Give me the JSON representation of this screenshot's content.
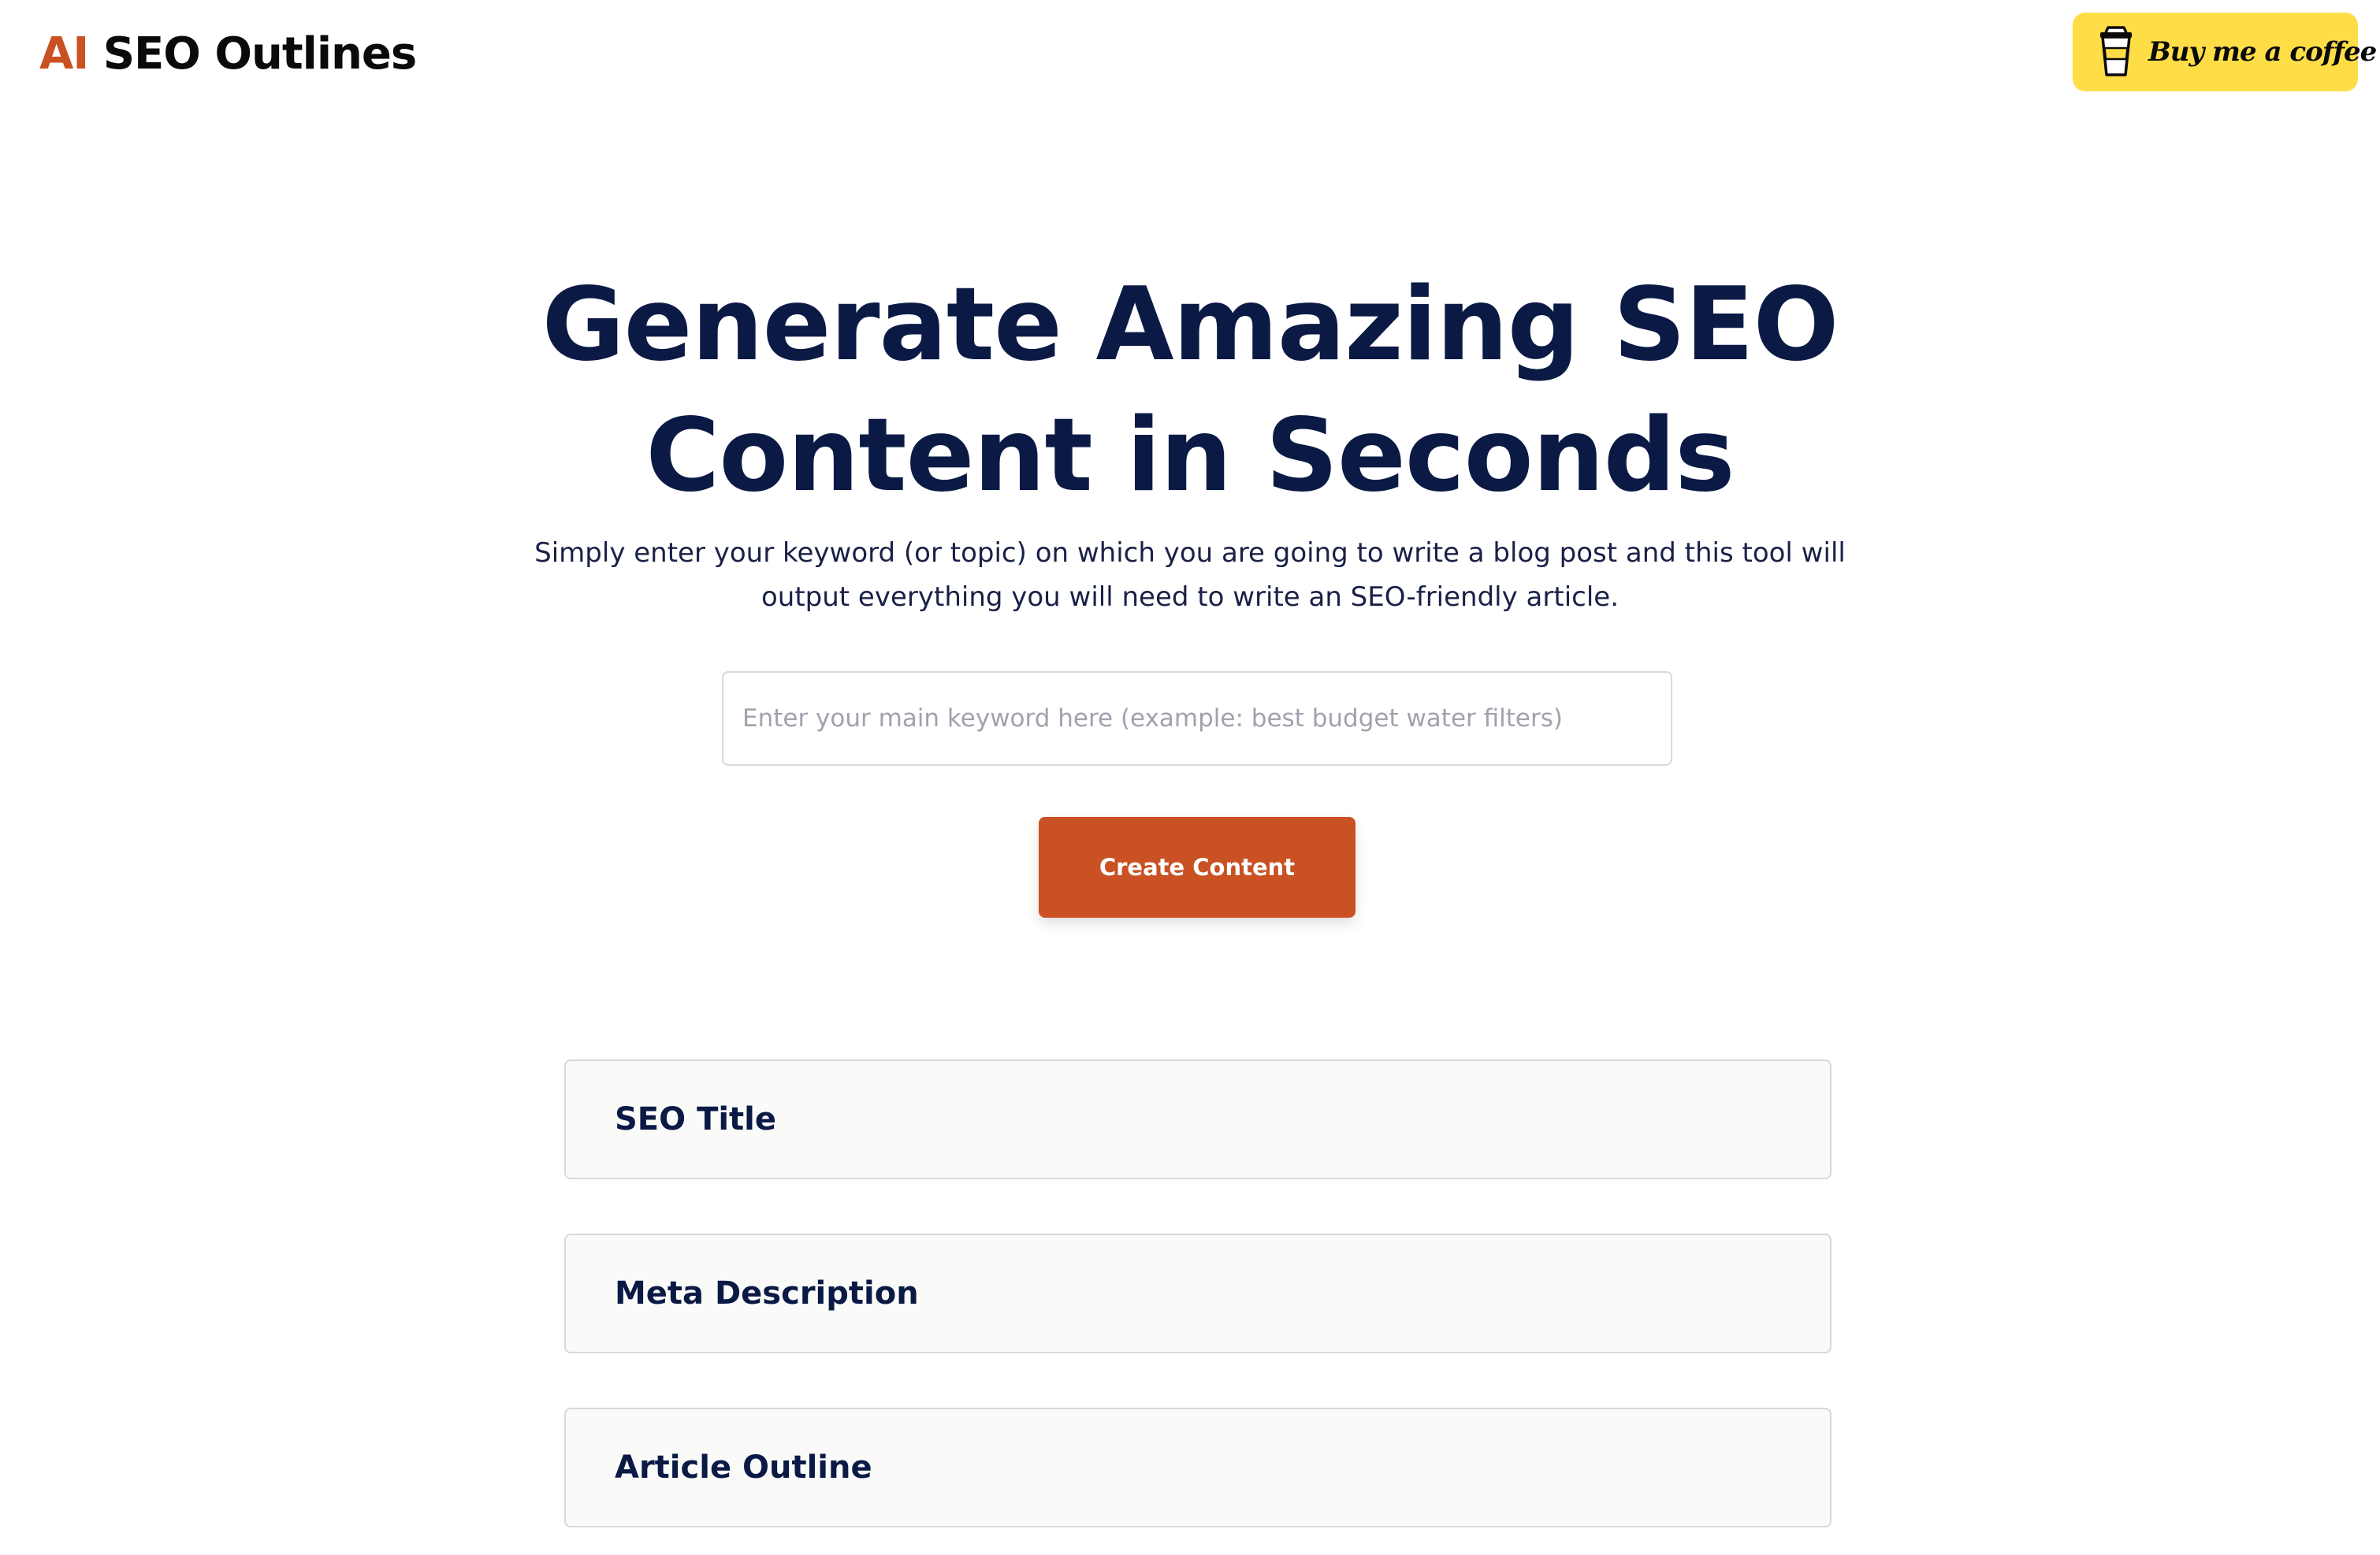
{
  "header": {
    "brand_accent": "AI",
    "brand_rest": "SEO Outlines",
    "coffee_label": "Buy me a coffee",
    "coffee_icon": "coffee-cup-icon",
    "coffee_color": "#ffdd47"
  },
  "hero": {
    "title_line1": "Generate Amazing SEO",
    "title_line2": "Content in Seconds",
    "subtitle": "Simply enter your keyword (or topic) on which you are going to write a blog post and this tool will output everything you will need to write an SEO-friendly article."
  },
  "form": {
    "keyword_value": "",
    "keyword_placeholder": "Enter your main keyword here (example: best budget water filters)",
    "submit_label": "Create Content"
  },
  "results": [
    {
      "label": "SEO Title"
    },
    {
      "label": "Meta Description"
    },
    {
      "label": "Article Outline"
    }
  ],
  "colors": {
    "accent": "#c95123",
    "heading": "#0b1a45",
    "panel_bg": "#fafaf9",
    "panel_border": "#d8d8dc"
  }
}
